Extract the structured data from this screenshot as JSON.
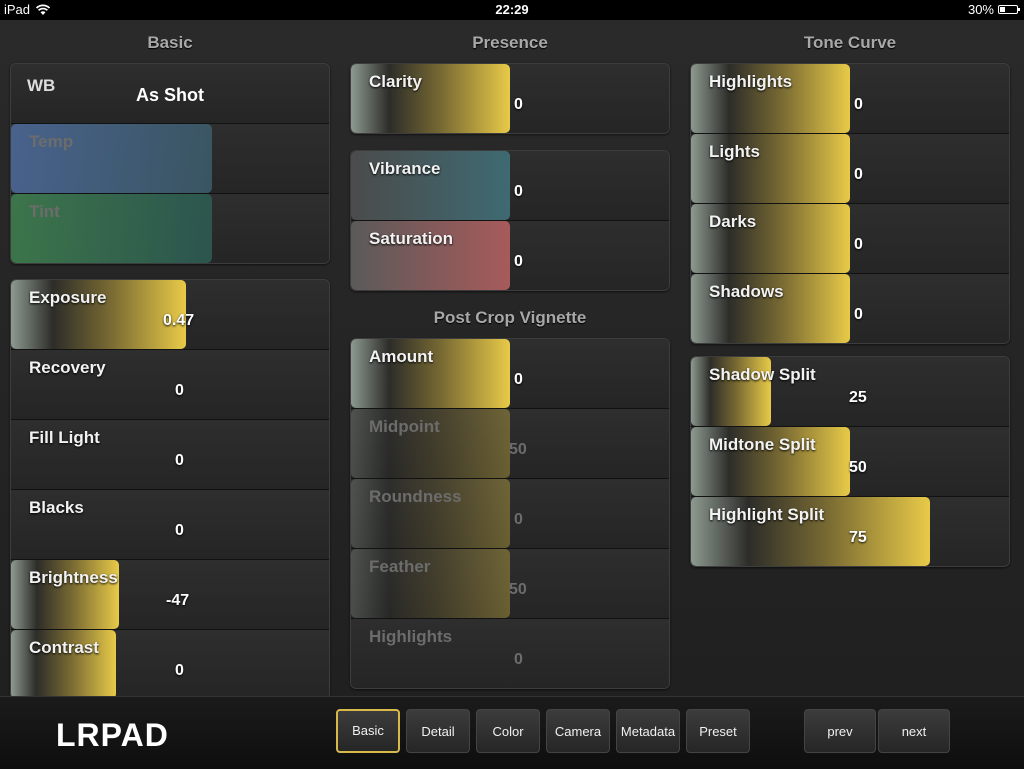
{
  "status_bar": {
    "device": "iPad",
    "time": "22:29",
    "battery": "30%"
  },
  "columns": {
    "basic": "Basic",
    "presence": "Presence",
    "tone_curve": "Tone Curve",
    "post_crop_vignette": "Post Crop Vignette"
  },
  "basic_wb": {
    "wb_label": "WB",
    "wb_value": "As Shot",
    "temp_label": "Temp",
    "tint_label": "Tint"
  },
  "basic": [
    {
      "label": "Exposure",
      "value": "0.47",
      "level": 0.55
    },
    {
      "label": "Recovery",
      "value": "0",
      "level": 0
    },
    {
      "label": "Fill Light",
      "value": "0",
      "level": 0
    },
    {
      "label": "Blacks",
      "value": "0",
      "level": 0
    },
    {
      "label": "Brightness",
      "value": "-47",
      "level": 0.34
    },
    {
      "label": "Contrast",
      "value": "0",
      "level": 0.33
    }
  ],
  "presence": {
    "clarity": {
      "label": "Clarity",
      "value": "0",
      "level": 0.5
    },
    "vibrance": {
      "label": "Vibrance",
      "value": "0",
      "level": 0.5
    },
    "saturation": {
      "label": "Saturation",
      "value": "0",
      "level": 0.5
    }
  },
  "vignette": [
    {
      "label": "Amount",
      "value": "0",
      "level": 0.5
    },
    {
      "label": "Midpoint",
      "value": "50",
      "level": 0.5
    },
    {
      "label": "Roundness",
      "value": "0",
      "level": 0.5
    },
    {
      "label": "Feather",
      "value": "50",
      "level": 0.5
    },
    {
      "label": "Highlights",
      "value": "0",
      "level": 0
    }
  ],
  "tone_curve": [
    {
      "label": "Highlights",
      "value": "0",
      "level": 0.5
    },
    {
      "label": "Lights",
      "value": "0",
      "level": 0.5
    },
    {
      "label": "Darks",
      "value": "0",
      "level": 0.5
    },
    {
      "label": "Shadows",
      "value": "0",
      "level": 0.5
    }
  ],
  "split": [
    {
      "label": "Shadow Split",
      "value": "25",
      "level": 0.25
    },
    {
      "label": "Midtone Split",
      "value": "50",
      "level": 0.5
    },
    {
      "label": "Highlight Split",
      "value": "75",
      "level": 0.75
    }
  ],
  "toolbar": {
    "logo": "LRPAD",
    "tabs": [
      "Basic",
      "Detail",
      "Color",
      "Camera",
      "Metadata",
      "Preset"
    ],
    "active_tab": "Basic",
    "prev": "prev",
    "next": "next"
  },
  "colors": {
    "accent": "#d7b94a",
    "fill_end": "#e8ca48"
  }
}
